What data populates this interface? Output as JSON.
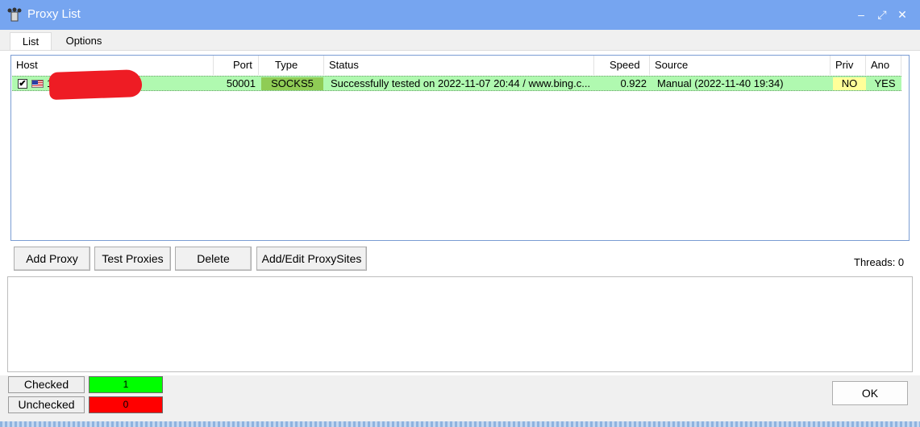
{
  "window": {
    "title": "Proxy List",
    "minimize": "–",
    "maximize": "⤢",
    "close": "✕"
  },
  "tabs": [
    {
      "label": "List",
      "active": true
    },
    {
      "label": "Options",
      "active": false
    }
  ],
  "table": {
    "headers": [
      "Host",
      "Port",
      "Type",
      "Status",
      "Speed",
      "Source",
      "Priv",
      "Ano"
    ],
    "rows": [
      {
        "checked": "✔",
        "flag": "us-flag",
        "host": "1",
        "port": "50001",
        "type": "SOCKS5",
        "status": "Successfully tested on 2022-11-07 20:44 / www.bing.c...",
        "speed": "0.922",
        "source": "Manual (2022-11-40 19:34)",
        "priv": "NO",
        "ano": "YES"
      }
    ]
  },
  "toolbar": {
    "add_proxy": "Add Proxy",
    "test_proxies": "Test Proxies",
    "delete": "Delete",
    "add_edit_sites": "Add/Edit ProxySites"
  },
  "threads": "Threads: 0",
  "stats": {
    "checked_label": "Checked",
    "checked_value": "1",
    "unchecked_label": "Unchecked",
    "unchecked_value": "0"
  },
  "ok": "OK",
  "colors": {
    "titlebar": "#76a5f0",
    "row_ok": "#b0f9b0",
    "socks": "#8fcc55",
    "priv_no": "#ffff99",
    "checked": "#00ff00",
    "unchecked": "#ff0000"
  },
  "icons": {
    "app": "server-proxy-icon",
    "flag": "us-flag-icon",
    "checkbox": "checkbox-checked-icon"
  }
}
